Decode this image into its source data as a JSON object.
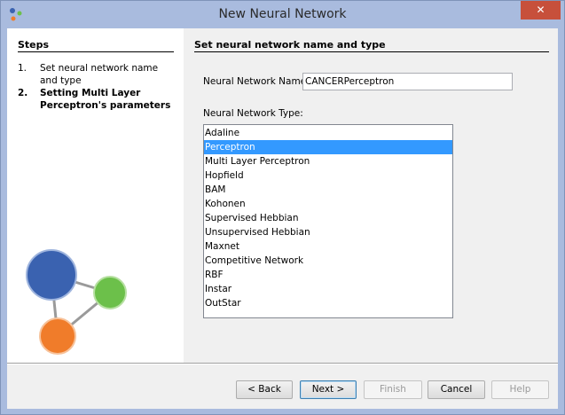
{
  "window": {
    "title": "New Neural Network",
    "close_glyph": "✕"
  },
  "steps": {
    "title": "Steps",
    "items": [
      {
        "num": "1.",
        "label": "Set neural network name and type"
      },
      {
        "num": "2.",
        "label": "Setting Multi Layer Perceptron's parameters"
      }
    ]
  },
  "panel": {
    "title": "Set neural network name and type",
    "name_label": "Neural Network Name:",
    "name_value": "CANCERPerceptron",
    "type_label": "Neural Network Type:",
    "types": [
      "Adaline",
      "Perceptron",
      "Multi Layer Perceptron",
      "Hopfield",
      "BAM",
      "Kohonen",
      "Supervised Hebbian",
      "Unsupervised Hebbian",
      "Maxnet",
      "Competitive Network",
      "RBF",
      "Instar",
      "OutStar"
    ],
    "selected_type": "Perceptron"
  },
  "buttons": {
    "back": "< Back",
    "next": "Next >",
    "finish": "Finish",
    "cancel": "Cancel",
    "help": "Help"
  },
  "colors": {
    "selection": "#3399ff",
    "node_blue": "#3a62b0",
    "node_green": "#6cc04a",
    "node_orange": "#f07c2a"
  }
}
